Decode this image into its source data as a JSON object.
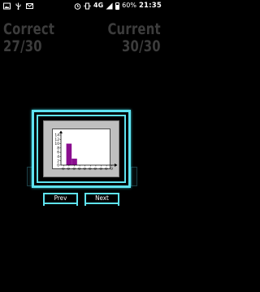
{
  "status_bar": {
    "icons_left": [
      "image-icon",
      "usb-icon",
      "mail-icon"
    ],
    "icons_right": [
      "alarm-icon",
      "vibrate-icon",
      "signal-icon",
      "battery-icon"
    ],
    "network": "4G",
    "battery": "60%",
    "time": "21:35"
  },
  "score": {
    "correct_label": "Correct",
    "correct_value": "27/30",
    "current_label": "Current",
    "current_value": "30/30"
  },
  "chart_data": {
    "type": "bar",
    "y_ticks": [
      "14",
      "12",
      "10",
      "8",
      "6",
      "4",
      "2",
      "0"
    ],
    "ylim": [
      0,
      14
    ],
    "categories": [
      "0",
      "0",
      "0",
      "0",
      "0",
      "0",
      "0",
      "0",
      "0",
      "0"
    ],
    "values": [
      0,
      10,
      3,
      0,
      0,
      0,
      0,
      0,
      0,
      0
    ],
    "bar_color": "#8a0d8f",
    "grid": false
  },
  "buttons": {
    "prev": "Prev",
    "next": "Next"
  },
  "colors": {
    "accent": "#5fe3f0",
    "score_text": "#3c3c3c",
    "background": "#000000"
  }
}
